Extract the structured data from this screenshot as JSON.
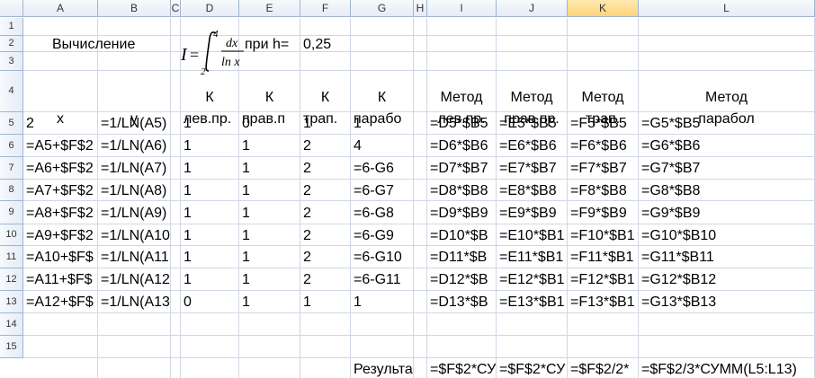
{
  "columns": [
    "A",
    "B",
    "C",
    "D",
    "E",
    "F",
    "G",
    "H",
    "I",
    "J",
    "K",
    "L"
  ],
  "selected_column": "K",
  "rows": [
    "1",
    "2",
    "3",
    "4",
    "5",
    "6",
    "7",
    "8",
    "9",
    "10",
    "11",
    "12",
    "13",
    "14",
    "15"
  ],
  "header": {
    "title": "Вычисление",
    "formula_text": "I = ∫ dx / ln x",
    "formula_lower": "2",
    "formula_upper": "4",
    "h_label": "при h=",
    "h_value": "0,25"
  },
  "col_titles_row3": {
    "D": "К",
    "E": "К",
    "F": "К",
    "G": "К",
    "I": "Метод",
    "J": "Метод",
    "K": "Метод",
    "L": "Метод"
  },
  "col_titles_row4": {
    "A": "x",
    "B": "y",
    "D": "лев.пр.",
    "E": "прав.п",
    "F": "трап.",
    "G": "парабо",
    "I": "лев.пр.",
    "J": "прав.пр.",
    "K": "трап.",
    "L": "парабол"
  },
  "table": [
    {
      "A": "2",
      "B": "=1/LN(A5)",
      "D": "1",
      "E": "0",
      "F": "1",
      "G": "1",
      "I": "=D5*$B5",
      "J": "=E5*$B5",
      "K": "=F5*$B5",
      "L": "=G5*$B5"
    },
    {
      "A": "=A5+$F$2",
      "B": "=1/LN(A6)",
      "D": "1",
      "E": "1",
      "F": "2",
      "G": "4",
      "I": "=D6*$B6",
      "J": "=E6*$B6",
      "K": "=F6*$B6",
      "L": "=G6*$B6"
    },
    {
      "A": "=A6+$F$2",
      "B": "=1/LN(A7)",
      "D": "1",
      "E": "1",
      "F": "2",
      "G": "=6-G6",
      "I": "=D7*$B7",
      "J": "=E7*$B7",
      "K": "=F7*$B7",
      "L": "=G7*$B7"
    },
    {
      "A": "=A7+$F$2",
      "B": "=1/LN(A8)",
      "D": "1",
      "E": "1",
      "F": "2",
      "G": "=6-G7",
      "I": "=D8*$B8",
      "J": "=E8*$B8",
      "K": "=F8*$B8",
      "L": "=G8*$B8"
    },
    {
      "A": "=A8+$F$2",
      "B": "=1/LN(A9)",
      "D": "1",
      "E": "1",
      "F": "2",
      "G": "=6-G8",
      "I": "=D9*$B9",
      "J": "=E9*$B9",
      "K": "=F9*$B9",
      "L": "=G9*$B9"
    },
    {
      "A": "=A9+$F$2",
      "B": "=1/LN(A10",
      "D": "1",
      "E": "1",
      "F": "2",
      "G": "=6-G9",
      "I": "=D10*$B",
      "J": "=E10*$B1",
      "K": "=F10*$B1",
      "L": "=G10*$B10"
    },
    {
      "A": "=A10+$F$",
      "B": "=1/LN(A11",
      "D": "1",
      "E": "1",
      "F": "2",
      "G": "=6-G10",
      "I": "=D11*$B",
      "J": "=E11*$B1",
      "K": "=F11*$B1",
      "L": "=G11*$B11"
    },
    {
      "A": "=A11+$F$",
      "B": "=1/LN(A12",
      "D": "1",
      "E": "1",
      "F": "2",
      "G": "=6-G11",
      "I": "=D12*$B",
      "J": "=E12*$B1",
      "K": "=F12*$B1",
      "L": "=G12*$B12"
    },
    {
      "A": "=A12+$F$",
      "B": "=1/LN(A13",
      "D": "0",
      "E": "1",
      "F": "1",
      "G": "1",
      "I": "=D13*$B",
      "J": "=E13*$B1",
      "K": "=F13*$B1",
      "L": "=G13*$B13"
    }
  ],
  "row15": {
    "G": "Результа",
    "I": "=$F$2*СУ",
    "J": "=$F$2*СУ",
    "K": "=$F$2/2*",
    "L": "=$F$2/3*СУММ(L5:L13)"
  },
  "colors": {
    "grid": "#d0d7e5",
    "header_border": "#9eb6ce",
    "selected_header": "#ffd47a"
  }
}
